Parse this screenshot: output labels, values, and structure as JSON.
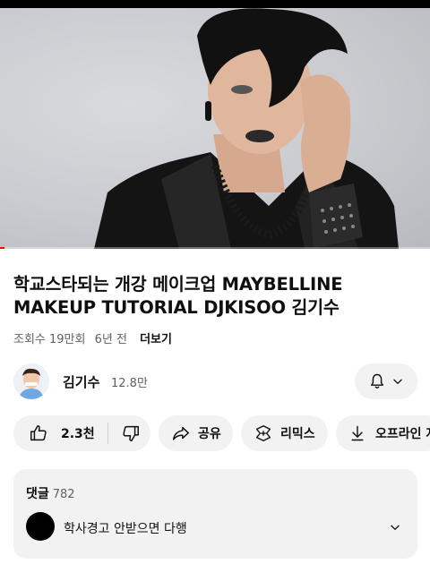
{
  "video": {
    "progress_fraction": 0.01,
    "accent_color": "#ff0000"
  },
  "title": "학교스타되는 개강 메이크업  MAYBELLINE MAKEUP TUTORIAL DJKISOO 김기수",
  "meta": {
    "views": "조회수 19만회",
    "age": "6년 전",
    "more": "더보기"
  },
  "channel": {
    "name": "김기수",
    "subscribers": "12.8만",
    "bell_icon": "bell-icon",
    "chevron_icon": "chevron-down-icon"
  },
  "actions": {
    "like_count": "2.3천",
    "share_label": "공유",
    "remix_label": "리믹스",
    "offline_label": "오프라인 저"
  },
  "comments": {
    "header": "댓글",
    "count": "782",
    "top_comment": "학사경고 안받으면 다행"
  }
}
